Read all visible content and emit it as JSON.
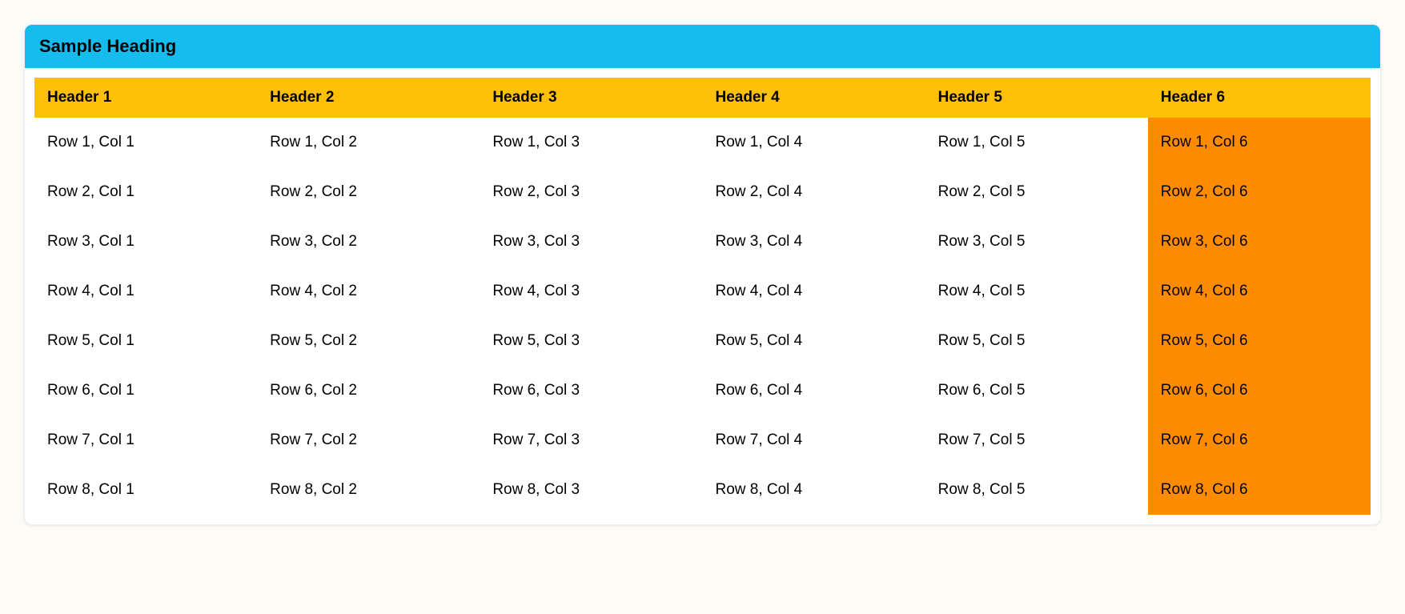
{
  "heading": "Sample Heading",
  "table": {
    "headers": [
      "Header 1",
      "Header 2",
      "Header 3",
      "Header 4",
      "Header 5",
      "Header 6"
    ],
    "rows": [
      [
        "Row 1, Col 1",
        "Row 1, Col 2",
        "Row 1, Col 3",
        "Row 1, Col 4",
        "Row 1, Col 5",
        "Row 1, Col 6"
      ],
      [
        "Row 2, Col 1",
        "Row 2, Col 2",
        "Row 2, Col 3",
        "Row 2, Col 4",
        "Row 2, Col 5",
        "Row 2, Col 6"
      ],
      [
        "Row 3, Col 1",
        "Row 3, Col 2",
        "Row 3, Col 3",
        "Row 3, Col 4",
        "Row 3, Col 5",
        "Row 3, Col 6"
      ],
      [
        "Row 4, Col 1",
        "Row 4, Col 2",
        "Row 4, Col 3",
        "Row 4, Col 4",
        "Row 4, Col 5",
        "Row 4, Col 6"
      ],
      [
        "Row 5, Col 1",
        "Row 5, Col 2",
        "Row 5, Col 3",
        "Row 5, Col 4",
        "Row 5, Col 5",
        "Row 5, Col 6"
      ],
      [
        "Row 6, Col 1",
        "Row 6, Col 2",
        "Row 6, Col 3",
        "Row 6, Col 4",
        "Row 6, Col 5",
        "Row 6, Col 6"
      ],
      [
        "Row 7, Col 1",
        "Row 7, Col 2",
        "Row 7, Col 3",
        "Row 7, Col 4",
        "Row 7, Col 5",
        "Row 7, Col 6"
      ],
      [
        "Row 8, Col 1",
        "Row 8, Col 2",
        "Row 8, Col 3",
        "Row 8, Col 4",
        "Row 8, Col 5",
        "Row 8, Col 6"
      ]
    ]
  }
}
